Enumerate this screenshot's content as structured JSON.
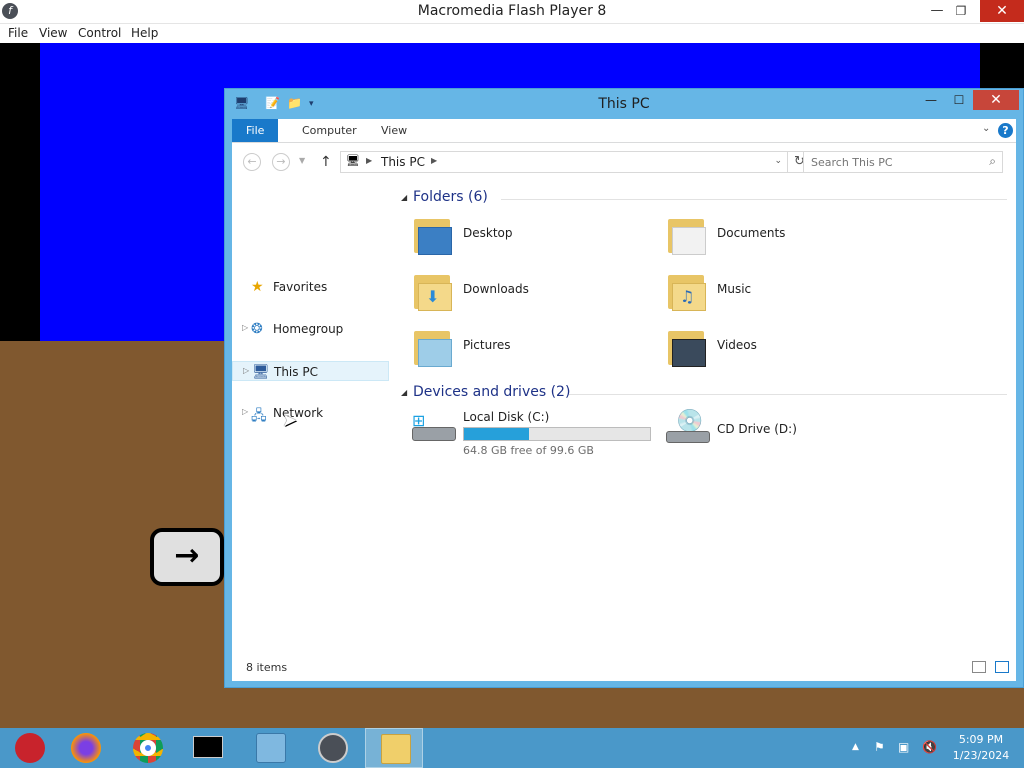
{
  "flash": {
    "title": "Macromedia Flash Player 8",
    "menu": [
      "File",
      "View",
      "Control",
      "Help"
    ],
    "arrow_glyph": "→"
  },
  "explorer": {
    "title": "This PC",
    "ribbon_tabs": [
      "File",
      "Computer",
      "View"
    ],
    "help": "?",
    "address": [
      "This PC"
    ],
    "search_placeholder": "Search This PC",
    "nav": [
      {
        "label": "Favorites",
        "icon": "star-icon"
      },
      {
        "label": "Homegroup",
        "icon": "homegroup-icon"
      },
      {
        "label": "This PC",
        "icon": "computer-icon",
        "selected": true
      },
      {
        "label": "Network",
        "icon": "network-icon"
      }
    ],
    "folders_header": "Folders (6)",
    "folders": [
      "Desktop",
      "Documents",
      "Downloads",
      "Music",
      "Pictures",
      "Videos"
    ],
    "devices_header": "Devices and drives (2)",
    "drives": [
      {
        "label": "Local Disk (C:)",
        "free_text": "64.8 GB free of 99.6 GB",
        "used_fraction": 0.35
      },
      {
        "label": "CD Drive (D:)"
      }
    ],
    "status": "8 items"
  },
  "taskbar": {
    "clock_time": "5:09 PM",
    "clock_date": "1/23/2024",
    "apps": [
      "ornament-icon",
      "firefox-icon",
      "chrome-icon",
      "cmd-icon",
      "control-panel-icon",
      "flash-icon",
      "file-explorer-icon"
    ]
  },
  "colors": {
    "sky": "#0000ff",
    "ground": "#80582f",
    "accent": "#1979ca",
    "taskbar": "#4a98c9"
  }
}
